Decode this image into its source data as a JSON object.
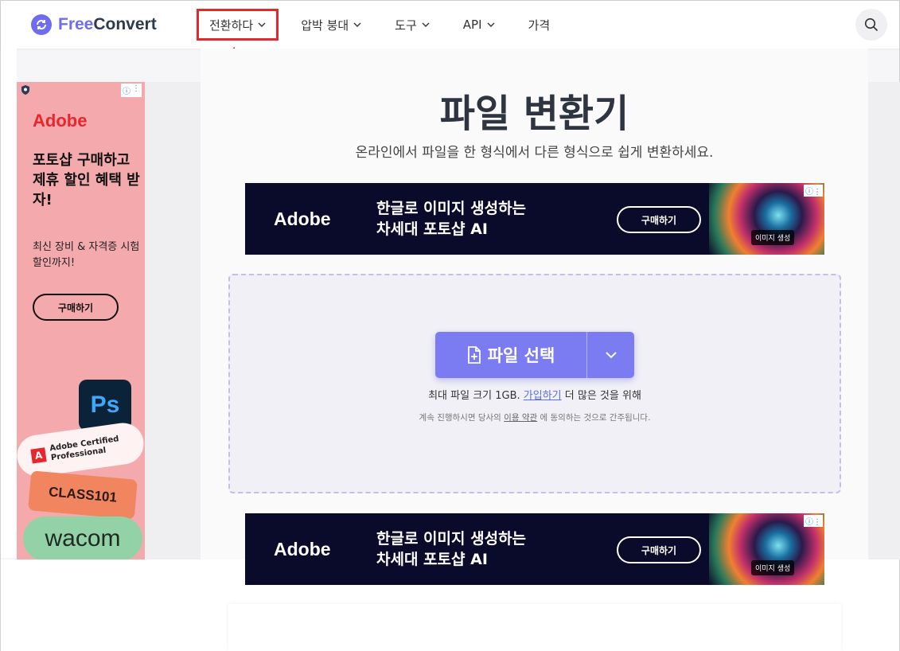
{
  "header": {
    "logo_free": "Free",
    "logo_convert": "Convert",
    "nav": [
      {
        "label": "전환하다",
        "has_dropdown": true,
        "highlighted": true
      },
      {
        "label": "압박 붕대",
        "has_dropdown": true
      },
      {
        "label": "도구",
        "has_dropdown": true
      },
      {
        "label": "API",
        "has_dropdown": true
      },
      {
        "label": "가격",
        "has_dropdown": false
      }
    ]
  },
  "left_ad": {
    "brand": "Adobe",
    "headline": "포토샵 구매하고 제휴 할인 혜택 받자!",
    "subline": "최신 장비 & 자격증 시험 할인까지!",
    "button": "구매하기",
    "ps_label": "Ps",
    "acp_label": "Adobe Certified Professional",
    "class_label": "CLASS101",
    "wacom_label": "wacom"
  },
  "main": {
    "title": "파일 변환기",
    "subtitle": "온라인에서 파일을 한 형식에서 다른 형식으로 쉽게 변환하세요."
  },
  "banner": {
    "brand": "Adobe",
    "line1": "한글로 이미지 생성하는",
    "line2": "차세대 포토샵 AI",
    "button": "구매하기",
    "tag": "이미지 생성"
  },
  "dropzone": {
    "choose_label": "파일 선택",
    "max_prefix": "최대 파일 크기 1GB.",
    "signup_link": "가입하기",
    "max_suffix": "더 많은 것을 위해",
    "terms_prefix": "계속 진행하시면 당사의",
    "terms_link": "이용 약관",
    "terms_suffix": "에 동의하는 것으로 간주됩니다."
  },
  "colors": {
    "accent": "#7c7cf2",
    "highlight_box": "#e8262d"
  }
}
